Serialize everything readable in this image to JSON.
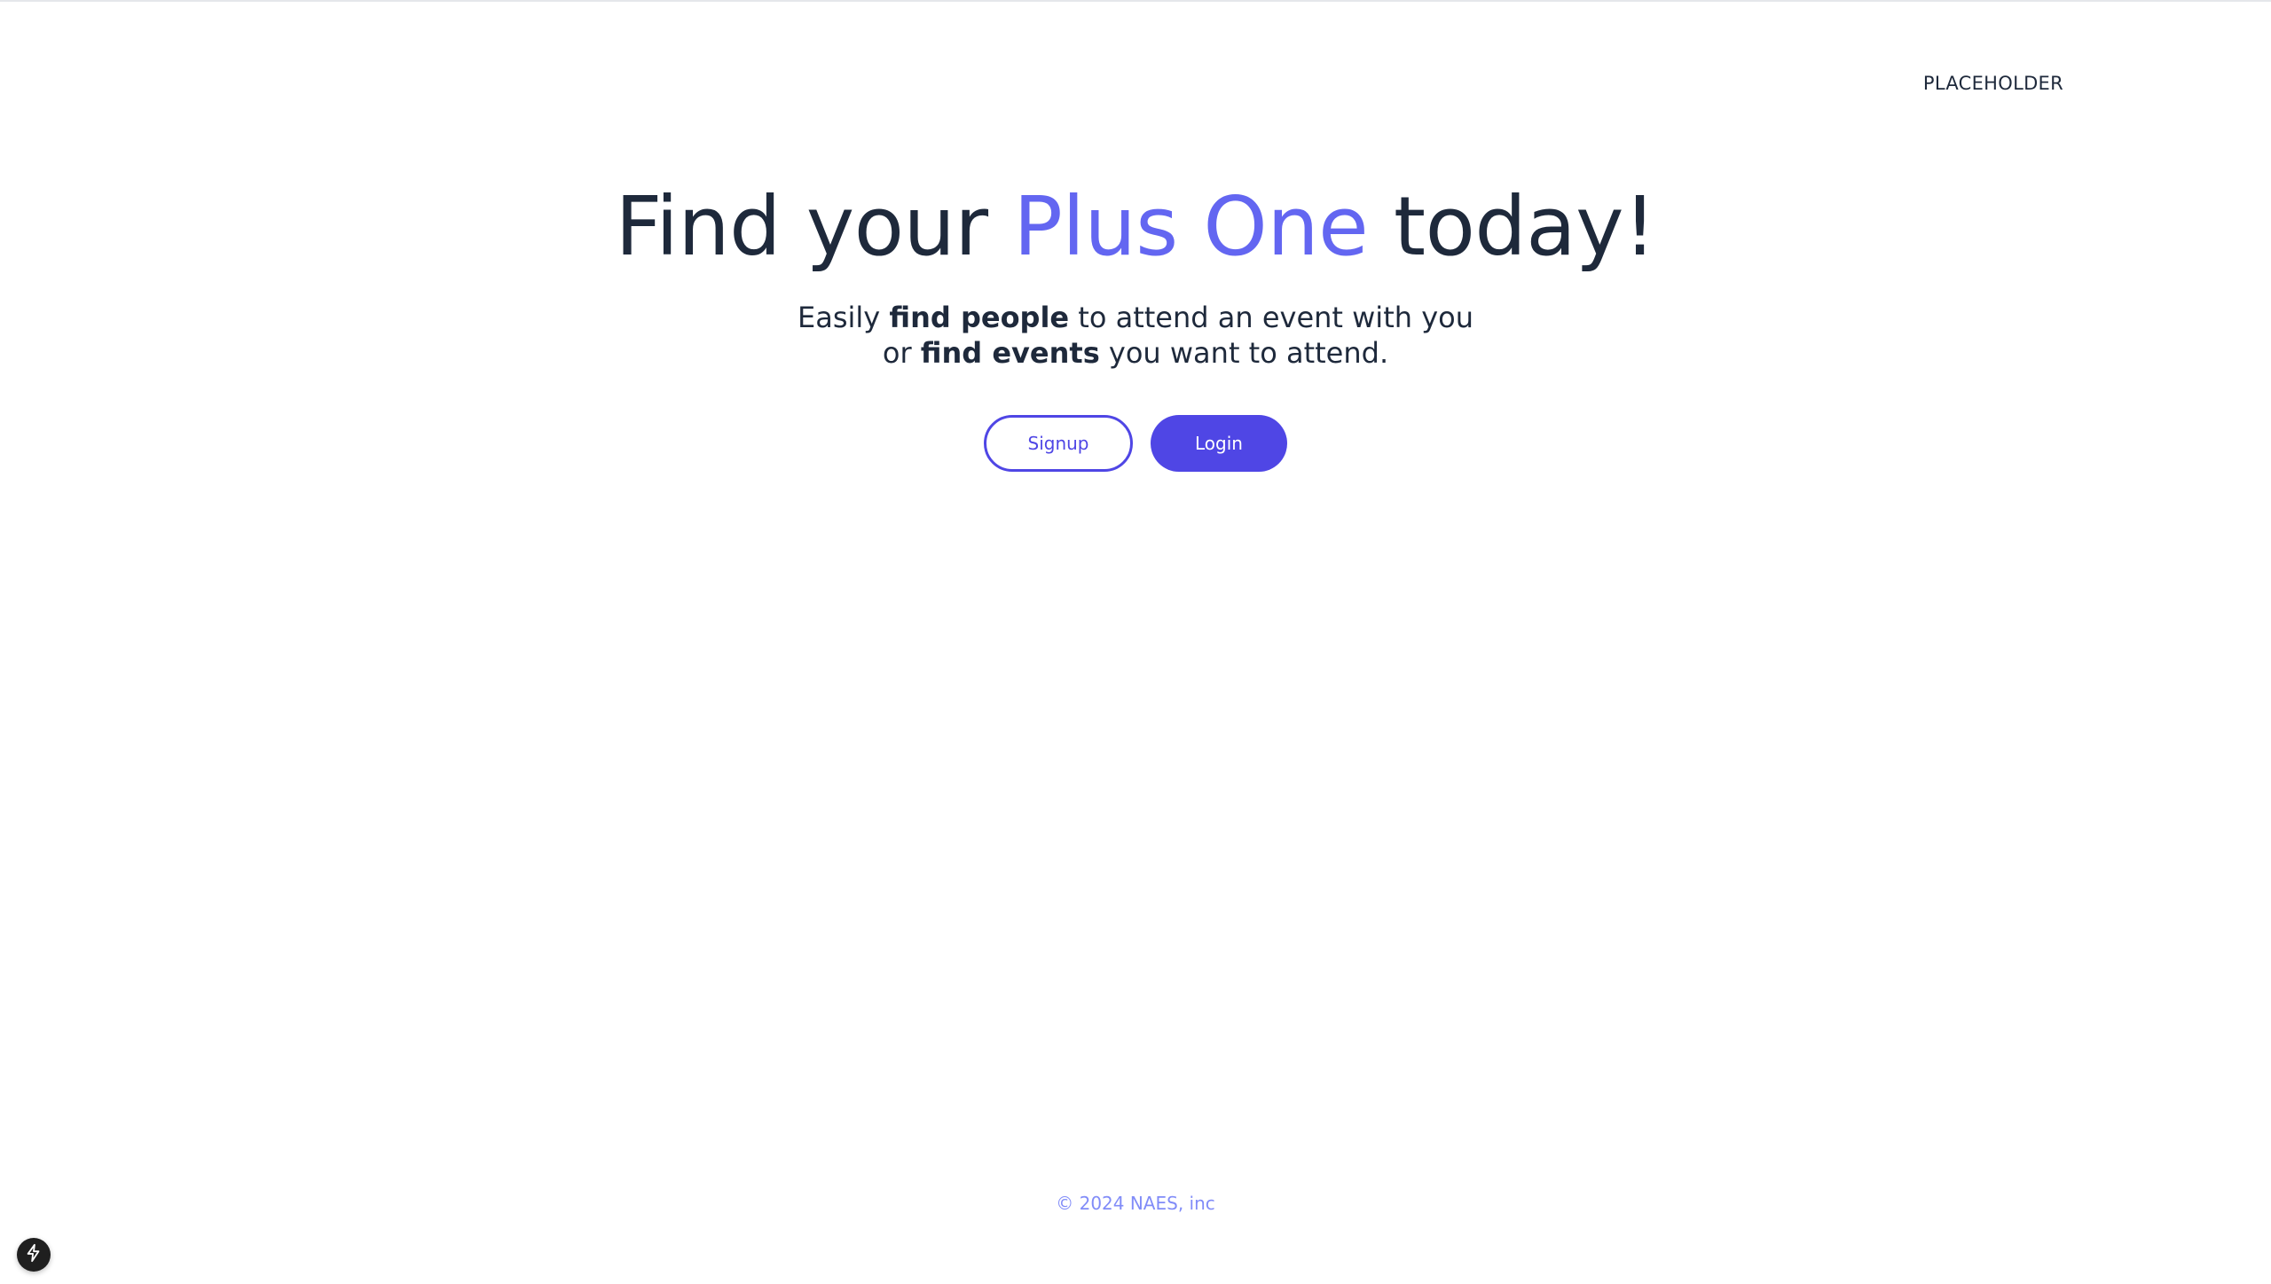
{
  "nav": {
    "link_label": "PLACEHOLDER"
  },
  "hero": {
    "title_part1": "Find your ",
    "title_accent": "Plus One",
    "title_part2": " today!",
    "sub_part1": "Easily ",
    "sub_bold1": "find people",
    "sub_part2": " to attend an event with you or ",
    "sub_bold2": "find events",
    "sub_part3": " you want to attend."
  },
  "actions": {
    "signup_label": "Signup",
    "login_label": "Login"
  },
  "footer": {
    "copyright": "© 2024 NAES, inc"
  },
  "colors": {
    "accent": "#6366f1",
    "primary_button": "#4f46e5",
    "text": "#1e293b",
    "footer_text": "#818cf8"
  },
  "icons": {
    "dev_badge": "lightning-bolt-icon"
  }
}
